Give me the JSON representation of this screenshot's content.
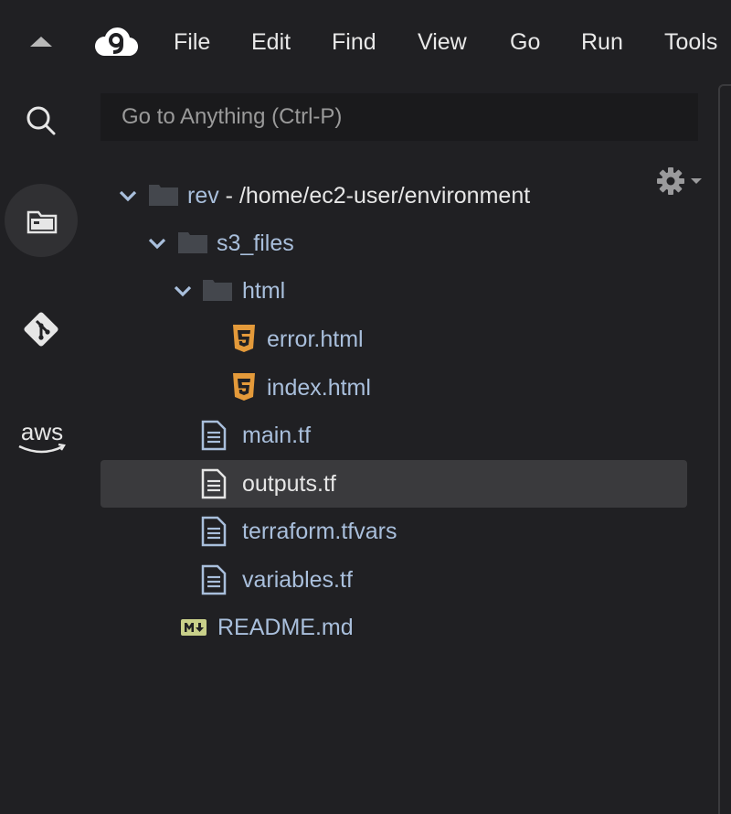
{
  "menubar": {
    "items": [
      "File",
      "Edit",
      "Find",
      "View",
      "Go",
      "Run",
      "Tools"
    ]
  },
  "rail": {
    "items": [
      {
        "icon": "search-icon"
      },
      {
        "icon": "folder-icon",
        "active": true
      },
      {
        "icon": "git-icon"
      },
      {
        "icon": "aws-icon",
        "text": "aws"
      }
    ]
  },
  "search": {
    "placeholder": "Go to Anything (Ctrl-P)"
  },
  "tree": {
    "root": {
      "name": "rev",
      "path": " - /home/ec2-user/environment"
    },
    "items": [
      {
        "name": "s3_files",
        "type": "folder"
      },
      {
        "name": "html",
        "type": "folder"
      },
      {
        "name": "error.html",
        "type": "html"
      },
      {
        "name": "index.html",
        "type": "html"
      },
      {
        "name": "main.tf",
        "type": "file"
      },
      {
        "name": "outputs.tf",
        "type": "file",
        "selected": true
      },
      {
        "name": "terraform.tfvars",
        "type": "file"
      },
      {
        "name": "variables.tf",
        "type": "file"
      },
      {
        "name": "README.md",
        "type": "markdown"
      }
    ]
  },
  "colors": {
    "background": "#202023",
    "label": "#a9bfdc",
    "selected_row": "#3a3a3d",
    "html_icon": "#e49a3a",
    "markdown_icon": "#c9d08a"
  }
}
